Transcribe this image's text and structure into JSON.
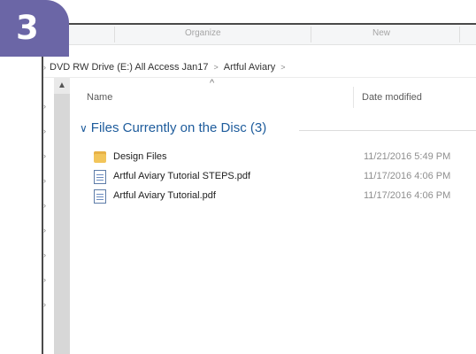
{
  "step_badge": "3",
  "ribbon": {
    "groups": [
      "Organize",
      "New"
    ]
  },
  "address": {
    "segments": [
      "DVD RW Drive (E:) All Access Jan17",
      "Artful Aviary"
    ],
    "separator": ">"
  },
  "columns": {
    "name": "Name",
    "date_modified": "Date modified",
    "sort_arrow": "^"
  },
  "group": {
    "chevron": "v",
    "title": "Files Currently on the Disc (3)"
  },
  "files": [
    {
      "name": "Design Files",
      "date": "11/21/2016 5:49 PM",
      "icon": "folder-icon"
    },
    {
      "name": "Artful Aviary Tutorial STEPS.pdf",
      "date": "11/17/2016 4:06 PM",
      "icon": "pdf-file-icon"
    },
    {
      "name": "Artful Aviary Tutorial.pdf",
      "date": "11/17/2016 4:06 PM",
      "icon": "pdf-file-icon"
    }
  ],
  "colors": {
    "badge": "#6b66a6",
    "group_title": "#1e5c9c",
    "folder": "#f2c55a",
    "scrollbar": "#d7d7d7"
  }
}
